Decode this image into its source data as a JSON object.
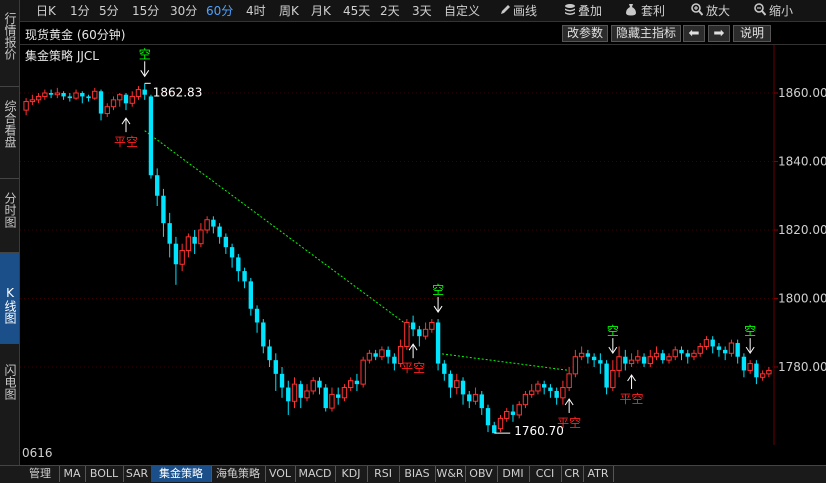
{
  "left_nav": [
    "行情报价",
    "综合看盘",
    "分时图",
    "K线图",
    "闪电图"
  ],
  "toolbar": {
    "periods": [
      "日K",
      "1分",
      "5分",
      "15分",
      "30分",
      "60分",
      "4时",
      "周K",
      "月K",
      "45天",
      "2天",
      "3天",
      "自定义"
    ],
    "active_period": "60分",
    "tools": [
      {
        "label": "画线",
        "icon": "pencil-icon"
      },
      {
        "label": "叠加",
        "icon": "stack-icon"
      },
      {
        "label": "套利",
        "icon": "moneybag-icon"
      },
      {
        "label": "放大",
        "icon": "zoom-in-icon"
      },
      {
        "label": "缩小",
        "icon": "zoom-out-icon"
      }
    ]
  },
  "header": {
    "title": "现货黄金 (60分钟)",
    "buttons": [
      "改参数",
      "隐藏主指标",
      "说明"
    ]
  },
  "strategy_label": "集金策略 JJCL",
  "bottom_left_label": "0616",
  "bottom_tabs": [
    "管理",
    "MA",
    "BOLL",
    "SAR",
    "集金策略",
    "海龟策略",
    "VOL",
    "MACD",
    "KDJ",
    "RSI",
    "BIAS",
    "W&R",
    "OBV",
    "DMI",
    "CCI",
    "CR",
    "ATR"
  ],
  "active_tab": "集金策略",
  "colors": {
    "up": "#ff3232",
    "down": "#00e5ff",
    "signal_green": "#00ff00",
    "signal_red": "#ff2020",
    "active": "#1b4f8a"
  },
  "chart_data": {
    "type": "candlestick",
    "y_ticks": [
      1780,
      1800,
      1820,
      1840,
      1860
    ],
    "ylim": [
      1757,
      1875
    ],
    "annotations": {
      "high": "1862.83",
      "low": "1760.70"
    },
    "signals": [
      {
        "label": "空",
        "bar": 19
      },
      {
        "label": "平空",
        "bar": 16
      },
      {
        "label": "空",
        "bar": 66
      },
      {
        "label": "平空",
        "bar": 62
      },
      {
        "label": "平空",
        "bar": 87
      },
      {
        "label": "空",
        "bar": 94
      },
      {
        "label": "平空",
        "bar": 97
      },
      {
        "label": "空",
        "bar": 116
      }
    ],
    "candles": [
      [
        1855,
        1857.5,
        1853.5,
        1858.5
      ],
      [
        1857.5,
        1858,
        1856.5,
        1859.5
      ],
      [
        1858,
        1859,
        1857,
        1860
      ],
      [
        1859,
        1860,
        1858,
        1861
      ],
      [
        1860,
        1859.5,
        1858.5,
        1861
      ],
      [
        1859.5,
        1860,
        1858.5,
        1861.5
      ],
      [
        1860,
        1859,
        1858,
        1860.5
      ],
      [
        1859,
        1858.5,
        1857.5,
        1860
      ],
      [
        1858.5,
        1860,
        1858,
        1861
      ],
      [
        1860,
        1859,
        1857,
        1860.5
      ],
      [
        1859,
        1858.5,
        1857.5,
        1859.5
      ],
      [
        1858.5,
        1860.5,
        1858,
        1861.5
      ],
      [
        1860.5,
        1854,
        1852,
        1861
      ],
      [
        1854,
        1856,
        1853,
        1857
      ],
      [
        1856,
        1858,
        1855,
        1859
      ],
      [
        1858,
        1859.5,
        1856,
        1860
      ],
      [
        1859.5,
        1857,
        1855,
        1860
      ],
      [
        1857,
        1859,
        1856,
        1860.5
      ],
      [
        1859,
        1861,
        1858,
        1862
      ],
      [
        1861,
        1859.5,
        1858,
        1862.83
      ],
      [
        1859,
        1836,
        1835,
        1859.5
      ],
      [
        1836,
        1830,
        1827,
        1838
      ],
      [
        1830,
        1822,
        1818,
        1832
      ],
      [
        1822,
        1816,
        1812,
        1825
      ],
      [
        1816,
        1810,
        1804,
        1818
      ],
      [
        1810,
        1814,
        1808,
        1816
      ],
      [
        1814,
        1818,
        1812,
        1819
      ],
      [
        1818,
        1816,
        1813,
        1820
      ],
      [
        1816,
        1820,
        1815,
        1822
      ],
      [
        1820,
        1823,
        1819,
        1824
      ],
      [
        1823,
        1821,
        1819,
        1824
      ],
      [
        1821,
        1818,
        1816,
        1822
      ],
      [
        1818,
        1815,
        1813,
        1819
      ],
      [
        1815,
        1812,
        1809,
        1816
      ],
      [
        1812,
        1808,
        1805,
        1813
      ],
      [
        1808,
        1805,
        1803,
        1809
      ],
      [
        1805,
        1797,
        1795,
        1806
      ],
      [
        1797,
        1793,
        1790,
        1798
      ],
      [
        1793,
        1786,
        1784,
        1794
      ],
      [
        1786,
        1782,
        1780,
        1788
      ],
      [
        1782,
        1778,
        1773,
        1784
      ],
      [
        1778,
        1774,
        1771,
        1780
      ],
      [
        1774,
        1770,
        1766,
        1776
      ],
      [
        1770,
        1775,
        1768,
        1777
      ],
      [
        1775,
        1771,
        1768,
        1776
      ],
      [
        1771,
        1773,
        1770,
        1775
      ],
      [
        1773,
        1776,
        1772,
        1777
      ],
      [
        1776,
        1774,
        1772,
        1777
      ],
      [
        1774,
        1768,
        1767,
        1775
      ],
      [
        1768,
        1772,
        1767,
        1774
      ],
      [
        1772,
        1771,
        1769,
        1774
      ],
      [
        1771,
        1774,
        1770,
        1775
      ],
      [
        1774,
        1776,
        1773,
        1777
      ],
      [
        1776,
        1775,
        1773,
        1778
      ],
      [
        1775,
        1782,
        1774,
        1783
      ],
      [
        1782,
        1784,
        1781,
        1785
      ],
      [
        1784,
        1783,
        1782,
        1785
      ],
      [
        1783,
        1785,
        1782,
        1786
      ],
      [
        1785,
        1783,
        1781,
        1786
      ],
      [
        1783,
        1781,
        1779,
        1784
      ],
      [
        1781,
        1786,
        1780,
        1788
      ],
      [
        1786,
        1793,
        1785,
        1794
      ],
      [
        1793,
        1791,
        1789,
        1795
      ],
      [
        1791,
        1789,
        1786,
        1792
      ],
      [
        1789,
        1791,
        1788,
        1793
      ],
      [
        1791,
        1793,
        1790,
        1794
      ],
      [
        1793,
        1781,
        1779,
        1794
      ],
      [
        1781,
        1778,
        1776,
        1782
      ],
      [
        1778,
        1774,
        1771,
        1779
      ],
      [
        1774,
        1776,
        1772,
        1778
      ],
      [
        1776,
        1772,
        1769,
        1777
      ],
      [
        1772,
        1770,
        1768,
        1773
      ],
      [
        1770,
        1772,
        1769,
        1774
      ],
      [
        1772,
        1768,
        1766,
        1773
      ],
      [
        1768,
        1763,
        1761,
        1769
      ],
      [
        1763,
        1760.7,
        1760.7,
        1764
      ],
      [
        1762,
        1765,
        1761,
        1766
      ],
      [
        1765,
        1767,
        1764,
        1768
      ],
      [
        1767,
        1766,
        1764,
        1769
      ],
      [
        1766,
        1769,
        1765,
        1770
      ],
      [
        1769,
        1772,
        1768,
        1773
      ],
      [
        1772,
        1773,
        1771,
        1775
      ],
      [
        1773,
        1775,
        1772,
        1776
      ],
      [
        1775,
        1774,
        1772,
        1776
      ],
      [
        1774,
        1773,
        1771,
        1775
      ],
      [
        1773,
        1771,
        1769,
        1774
      ],
      [
        1771,
        1774,
        1769,
        1776
      ],
      [
        1774,
        1778,
        1773,
        1780
      ],
      [
        1778,
        1783,
        1777,
        1785
      ],
      [
        1783,
        1784,
        1782,
        1786
      ],
      [
        1784,
        1783,
        1781,
        1785
      ],
      [
        1783,
        1782,
        1780,
        1784
      ],
      [
        1782,
        1781,
        1778,
        1784
      ],
      [
        1781,
        1774,
        1772,
        1782
      ],
      [
        1774,
        1779,
        1773,
        1782
      ],
      [
        1779,
        1783,
        1777,
        1786
      ],
      [
        1783,
        1781,
        1779,
        1785
      ],
      [
        1781,
        1782,
        1780,
        1784
      ],
      [
        1782,
        1783,
        1781,
        1785
      ],
      [
        1783,
        1781,
        1780,
        1784
      ],
      [
        1781,
        1783,
        1780,
        1785
      ],
      [
        1783,
        1784,
        1782,
        1786
      ],
      [
        1784,
        1782,
        1781,
        1785
      ],
      [
        1782,
        1783,
        1781,
        1784
      ],
      [
        1783,
        1785,
        1782,
        1786
      ],
      [
        1785,
        1784,
        1782,
        1786
      ],
      [
        1784,
        1783,
        1781,
        1785
      ],
      [
        1783,
        1784,
        1782,
        1785
      ],
      [
        1784,
        1786,
        1783,
        1787
      ],
      [
        1786,
        1788,
        1785,
        1789
      ],
      [
        1788,
        1786,
        1784,
        1789
      ],
      [
        1786,
        1785,
        1783,
        1787
      ],
      [
        1785,
        1784,
        1782,
        1786
      ],
      [
        1784,
        1787,
        1783,
        1788
      ],
      [
        1787,
        1783,
        1781,
        1788
      ],
      [
        1783,
        1779,
        1777,
        1784
      ],
      [
        1779,
        1781,
        1778,
        1782
      ],
      [
        1781,
        1777,
        1775,
        1782
      ],
      [
        1777,
        1778,
        1776,
        1779
      ],
      [
        1778,
        1779,
        1777,
        1780
      ]
    ]
  }
}
